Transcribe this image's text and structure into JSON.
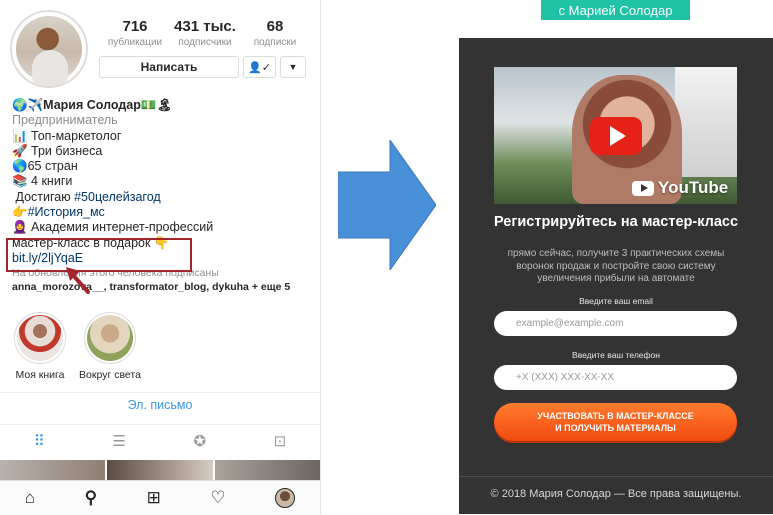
{
  "profile": {
    "stats": [
      {
        "value": "716",
        "label": "публикации"
      },
      {
        "value": "431 тыс.",
        "label": "подписчики"
      },
      {
        "value": "68",
        "label": "подписки"
      }
    ],
    "message_button": "Написать",
    "follow_button_glyph": "👤✓",
    "dropdown_glyph": "▼",
    "name": "🌍✈️Мария Солодар💵🏝",
    "category": "Предприниматель",
    "bio_lines": [
      "📊 Топ-маркетолог",
      "🚀 Три бизнеса",
      "🌎65 стран",
      "📚 4 книги",
      "👉"
    ],
    "bio_goal_prefix": "Достигаю ",
    "bio_goal_tag": "#50целейзагод",
    "bio_history_tag": "#История_мс",
    "bio_academy": "🧕 Академия интернет-профессий",
    "bio_gift": "мастер-класс в подарок 👇",
    "bio_link": "bit.ly/2ljYqaE",
    "followed_by_text": "На обновления этого человека подписаны",
    "followed_by_names": "anna_morozova__, transformator_blog, dykuha",
    "followed_by_more": " + еще 5",
    "highlights": [
      {
        "label": "Моя книга",
        "color_a": "#c9c2be",
        "color_b": "#c0392b"
      },
      {
        "label": "Вокруг света",
        "color_a": "#d9c7a8",
        "color_b": "#8fa35a"
      }
    ],
    "email_link": "Эл. письмо",
    "tab_icons": [
      "grid-icon",
      "list-icon",
      "tagged-star-icon",
      "tagged-person-icon"
    ],
    "bottom_nav_icons": [
      "home-icon",
      "search-icon",
      "add-icon",
      "heart-icon",
      "profile-avatar-icon"
    ]
  },
  "landing": {
    "top_tag": "с Марией Солодар",
    "video_logo": "YouTube",
    "heading": "Регистрируйтесь на мастер-класс",
    "description": "прямо сейчас, получите 3 практических схемы воронок продаж и постройте свою систему увеличения прибыли на автомате",
    "email_label": "Введите ваш email",
    "email_placeholder": "example@example.com",
    "phone_label": "Введите ваш телефон",
    "phone_placeholder": "+X (XXX) XXX-XX-XX",
    "cta_line1": "УЧАСТВОВАТЬ В МАСТЕР-КЛАССЕ",
    "cta_line2": "И ПОЛУЧИТЬ МАТЕРИАЛЫ",
    "footer": "© 2018 Мария Солодар — Все права защищены."
  },
  "colors": {
    "highlight_box": "#a3242a",
    "arrow_blue": "#4a90d9",
    "landing_bg": "#333333",
    "cta_orange": "#f24a0e",
    "teal": "#1fc2a6",
    "link_blue": "#3897f0"
  }
}
